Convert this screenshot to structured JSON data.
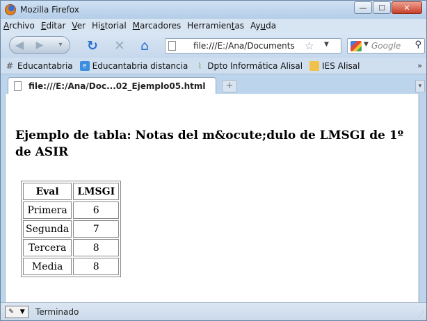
{
  "window": {
    "title": "Mozilla Firefox",
    "minimize": "—",
    "maximize": "☐",
    "close": "✕"
  },
  "menu": [
    "Archivo",
    "Editar",
    "Ver",
    "Historial",
    "Marcadores",
    "Herramientas",
    "Ayuda"
  ],
  "menu_underline": [
    "A",
    "E",
    "V",
    "s",
    "M",
    "t",
    "u"
  ],
  "nav": {
    "url": "file:///E:/Ana/Documents",
    "search_placeholder": "Google"
  },
  "bookmarks": [
    "Educantabria",
    "Educantabria distancia",
    "Dpto Informática Alisal",
    "IES Alisal"
  ],
  "bookmarks_more": "»",
  "tab": {
    "label": "file:///E:/Ana/Doc...02_Ejemplo05.html"
  },
  "page": {
    "heading": "Ejemplo de tabla: Notas del m&ocute;dulo de LMSGI de 1º de ASIR",
    "table_headers": [
      "Eval",
      "LMSGI"
    ],
    "table_rows": [
      [
        "Primera",
        "6"
      ],
      [
        "Segunda",
        "7"
      ],
      [
        "Tercera",
        "8"
      ],
      [
        "Media",
        "8"
      ]
    ]
  },
  "status": {
    "text": "Terminado"
  },
  "icons": {
    "app": "firefox-icon",
    "reload": "reload-icon",
    "stop": "stop-icon",
    "home": "home-icon",
    "bookmark_star": "star-icon",
    "search": "search-icon"
  }
}
